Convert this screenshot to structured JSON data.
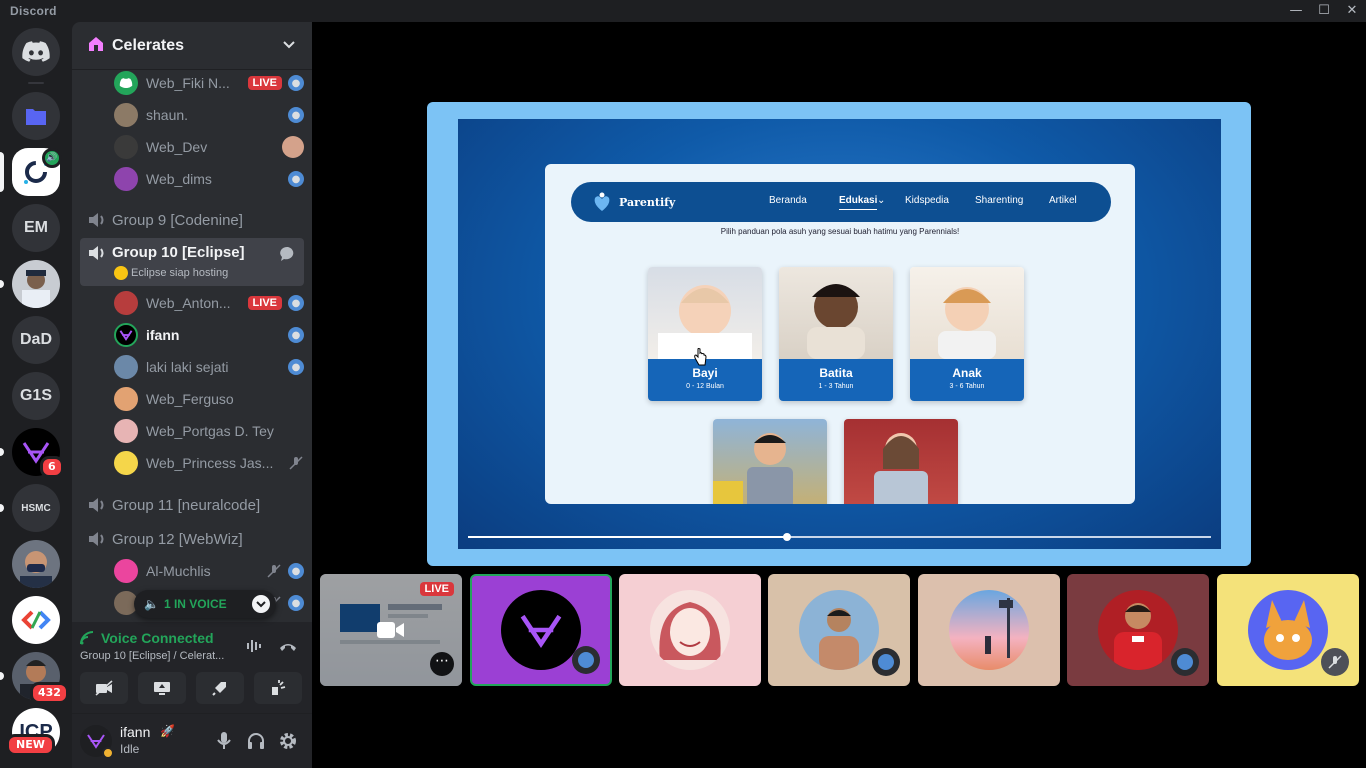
{
  "titlebar": {
    "app": "Discord"
  },
  "rail": {
    "servers": [
      "EM",
      "DaD",
      "G1S",
      "HSMC"
    ],
    "badges": {
      "ifann_server": "6",
      "user_server": "432",
      "new_label": "NEW"
    }
  },
  "guild": {
    "name": "Celerates"
  },
  "channels": {
    "group_prev_users": [
      {
        "name": "Web_Fiki N...",
        "live": "LIVE"
      },
      {
        "name": "shaun."
      },
      {
        "name": "Web_Dev"
      },
      {
        "name": "Web_dims"
      }
    ],
    "group9": "Group 9 [Codenine]",
    "group10": {
      "name": "Group 10 [Eclipse]",
      "status": "Eclipse siap hosting"
    },
    "group10_users": [
      {
        "name": "Web_Anton...",
        "live": "LIVE"
      },
      {
        "name": "ifann"
      },
      {
        "name": "laki laki sejati"
      },
      {
        "name": "Web_Ferguso"
      },
      {
        "name": "Web_Portgas D. Tey"
      },
      {
        "name": "Web_Princess Jas..."
      }
    ],
    "group11": "Group 11 [neuralcode]",
    "group12": "Group 12 [WebWiz]",
    "group12_users": [
      {
        "name": "Al-Muchlis"
      }
    ],
    "in_voice": "1 IN VOICE"
  },
  "voice": {
    "title": "Voice Connected",
    "subtitle": "Group 10 [Eclipse] / Celerat..."
  },
  "user": {
    "name": "ifann",
    "status": "Idle"
  },
  "stream": {
    "site": {
      "brand": "Parentify",
      "nav": [
        "Beranda",
        "Edukasi",
        "Kidspedia",
        "Sharenting",
        "Artikel"
      ],
      "tagline": "Pilih panduan pola asuh yang sesuai buah hatimu yang Parennials!",
      "cards": [
        {
          "title": "Bayi",
          "sub": "0 - 12 Bulan"
        },
        {
          "title": "Batita",
          "sub": "1 - 3 Tahun"
        },
        {
          "title": "Anak",
          "sub": "3 - 6 Tahun"
        }
      ]
    },
    "progress": 0.43
  },
  "tiles": {
    "live": "LIVE"
  },
  "colors": {
    "accent": "#5865f2",
    "online": "#23a55a",
    "live": "#da373c"
  }
}
